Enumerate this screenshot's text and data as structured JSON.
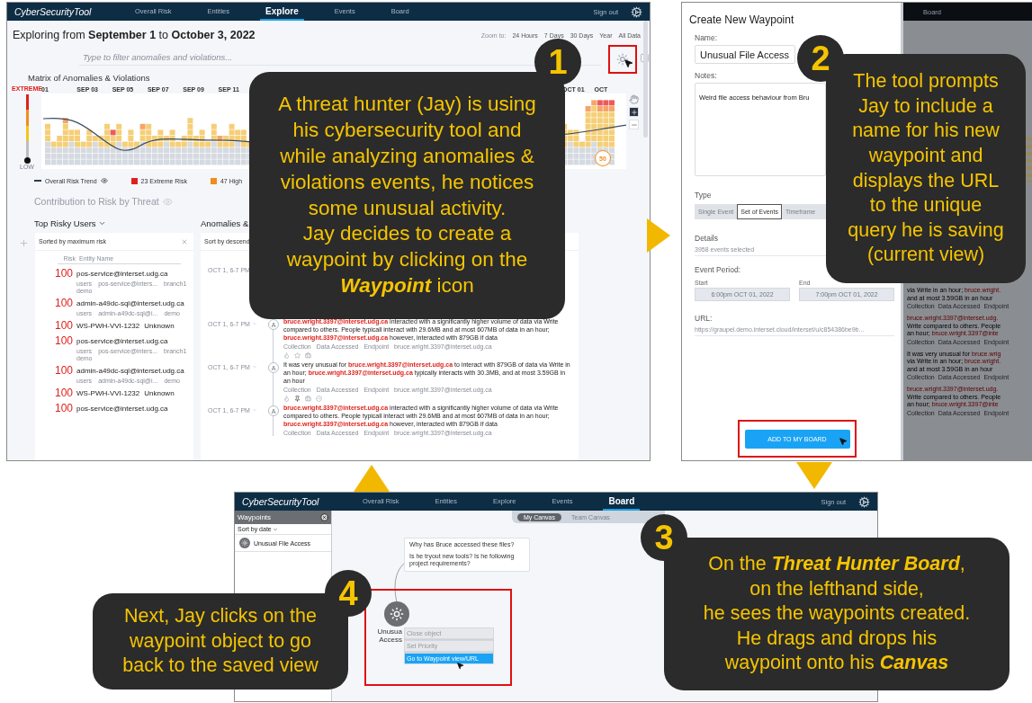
{
  "explore_screen": {
    "nav": {
      "brand": "CyberSecurityTool",
      "tabs": [
        {
          "label": "Overall Risk",
          "selected": false
        },
        {
          "label": "Entities",
          "selected": false
        },
        {
          "label": "Explore",
          "selected": true
        },
        {
          "label": "Events",
          "selected": false
        },
        {
          "label": "Board",
          "selected": false
        }
      ],
      "sign_out": "Sign out"
    },
    "heading": "Exploring from **September 1** to **October 3, 2022**",
    "zoom": {
      "label": "Zoom to:",
      "options": [
        "24 Hours",
        "7 Days",
        "30 Days",
        "Year",
        "All Data"
      ]
    },
    "filter": {
      "placeholder": "Type to filter anomalies and violations..."
    },
    "matrix": {
      "title": "Matrix of Anomalies & Violations",
      "scale_high": "EXTREME",
      "scale_low": "LOW",
      "dates": [
        "01",
        "SEP 03",
        "SEP 05",
        "SEP 07",
        "SEP 09",
        "SEP 11"
      ],
      "dates_right": [
        "OCT 01",
        "OCT"
      ],
      "trend_badge": "50"
    },
    "legend": [
      {
        "kind": "line",
        "label": "Overall Risk Trend"
      },
      {
        "kind": "swatch",
        "color": "#e0201b",
        "label": "23 Extreme Risk"
      },
      {
        "kind": "swatch",
        "color": "#f28c1e",
        "label": "47 High"
      }
    ],
    "contribution_title": "Contribution to Risk by Threat",
    "users": {
      "title": "Top Risky Users",
      "sort_label": "Sorted by maximum risk",
      "columns": [
        "Risk",
        "Entity Name"
      ],
      "rows": [
        {
          "risk": "100",
          "name": "pos-service@interset.udg.ca",
          "tags": [
            "users",
            "pos-service@inters...",
            "branch1",
            "demo"
          ]
        },
        {
          "risk": "100",
          "name": "admin-a49dc-sql@interset.udg.ca",
          "tags": [
            "users",
            "admin-a49dc-sql@i...",
            "demo"
          ]
        },
        {
          "risk": "100",
          "name": "WS-PWH-VVI-1232",
          "extra": "Unknown",
          "tags": []
        },
        {
          "risk": "100",
          "name": "pos-service@interset.udg.ca",
          "tags": [
            "users",
            "pos-service@inters...",
            "branch1",
            "demo"
          ]
        },
        {
          "risk": "100",
          "name": "admin-a49dc-sql@interset.udg.ca",
          "tags": [
            "users",
            "admin-a49dc-sql@i...",
            "demo"
          ]
        },
        {
          "risk": "100",
          "name": "WS-PWH-VVI-1232",
          "extra": "Unknown",
          "tags": []
        },
        {
          "risk": "100",
          "name": "pos-service@interset.udg.ca",
          "tags": []
        }
      ]
    },
    "anomalies": {
      "title": "Anomalies &",
      "sort_label": "Sort by descend",
      "events": [
        {
          "time": "OCT 1, 6-7 PM"
        },
        {
          "time": "OCT 1, 6-7 PM",
          "badge": "A",
          "text": "**bruce.wright.3397@interset.udg.ca** interacted with a significantly higher volume of data via Write compared to others. People typicall interact with 29.6MB and at most 607MB of data in an hour; **bruce.wright.3397@interset.udg.ca** however, interacted with 879GB if data",
          "tags": [
            "Collection",
            "Data Accessed",
            "Endpoint",
            "bruce.wright.3397@interset.udg.ca"
          ]
        },
        {
          "time": "OCT 1, 6-7 PM",
          "badge": "A",
          "text": "It was very unusual for **bruce.wright.3397@interset.udg.ca** to interact with 879GB of data via Write in an hour; **bruce.wright.3397@interset.udg.ca** typically interacts with 30.3MB, and at most 3.59GB in an hour",
          "tags": [
            "Collection",
            "Data Accessed",
            "Endpoint",
            "bruce.wright.3397@interset.udg.ca"
          ]
        },
        {
          "time": "OCT 1, 6-7 PM",
          "badge": "A",
          "text": "**bruce.wright.3397@interset.udg.ca** interacted with a significantly higher volume of data via Write compared to others. People typicall interact with 29.6MB and at most 607MB of data in an hour; **bruce.wright.3397@interset.udg.ca** however, interacted with 879GB if data",
          "tags": [
            "Collection",
            "Data Accessed",
            "Endpoint",
            "bruce.wright.3397@interset.udg.ca"
          ]
        }
      ]
    }
  },
  "waypoint_screen": {
    "title": "Create New Waypoint",
    "name_label": "Name:",
    "name_value": "Unusual File Access",
    "notes_label": "Notes:",
    "notes_value": "Weird file access behaviour from Bru",
    "type_label": "Type",
    "type_options": [
      {
        "label": "Single Event",
        "selected": false
      },
      {
        "label": "Set of Events",
        "selected": true
      },
      {
        "label": "Timeframe",
        "selected": false
      }
    ],
    "details_label": "Details",
    "details_value": "3958 events selected",
    "period_label": "Event Period:",
    "start_label": "Start",
    "start_value": "6:00pm OCT 01, 2022",
    "end_label": "End",
    "end_value": "7:00pm OCT 01, 2022",
    "url_label": "URL:",
    "url_value": "https://graupel.demo.interset.cloud/interset/u/c854386be9b...",
    "button": "ADD TO MY BOARD",
    "background": {
      "tab": "Board",
      "entries": [
        {
          "lines": [
            "via Write in an hour; **bruce.wright.**",
            "and at most 3.59GB in an hour"
          ],
          "tags": [
            "Collection",
            "Data Accessed",
            "Endpoint"
          ]
        },
        {
          "lines": [
            "**bruce.wright.3397@interset.udg.**",
            "Write compared to others. People",
            "an hour; **bruce.wright.3397@inte**"
          ],
          "tags": [
            "Collection",
            "Data Accessed",
            "Endpoint"
          ]
        },
        {
          "lines": [
            "It was very unusual for **bruce.wrig**",
            "via Write in an hour; **bruce.wright.**",
            "and at most 3.59GB in an hour"
          ],
          "tags": [
            "Collection",
            "Data Accessed",
            "Endpoint"
          ]
        },
        {
          "lines": [
            "**bruce.wright.3397@interset.udg.**",
            "Write compared to others. People",
            "an hour; **bruce.wright.3397@inte**"
          ],
          "tags": [
            "Collection",
            "Data Accessed",
            "Endpoint"
          ]
        }
      ]
    }
  },
  "board_screen": {
    "nav": {
      "brand": "CyberSecurityTool",
      "tabs": [
        {
          "label": "Overall Risk",
          "selected": false
        },
        {
          "label": "Entities",
          "selected": false
        },
        {
          "label": "Explore",
          "selected": false
        },
        {
          "label": "Events",
          "selected": false
        },
        {
          "label": "Board",
          "selected": true
        }
      ],
      "sign_out": "Sign out"
    },
    "sidebar": {
      "title": "Waypoints",
      "sort_label": "Sort by date",
      "items": [
        {
          "label": "Unusual File Access"
        }
      ]
    },
    "canvas_tabs": [
      {
        "label": "My Canvas",
        "selected": true
      },
      {
        "label": "Team Canvas",
        "selected": false
      }
    ],
    "note": {
      "lines": [
        "Why has Bruce accessed these files?",
        "Is he tryout new tools? Is he following project requirements?"
      ]
    },
    "node": {
      "label_lines": [
        "Unusua",
        "Access"
      ]
    },
    "menu": [
      {
        "label": "Close object",
        "selected": false
      },
      {
        "label": "Set Priority",
        "selected": false
      },
      {
        "label": "Go to Waypoint view/URL",
        "selected": true
      }
    ]
  },
  "callouts": [
    {
      "number": "1",
      "lines": [
        "A threat hunter (Jay) is using",
        "his cybersecurity tool and",
        "while analyzing anomalies &",
        "violations events, he notices",
        "some unusual activity.",
        "Jay decides to create a",
        "waypoint by clicking on the",
        "**Waypoint** icon"
      ]
    },
    {
      "number": "2",
      "lines": [
        "The tool prompts",
        "Jay to include a",
        "name for his new",
        "waypoint and",
        "displays the URL",
        "to the unique",
        "query he is saving",
        "(current view)"
      ]
    },
    {
      "number": "4",
      "lines": [
        "Next, Jay clicks on the",
        "waypoint object to go",
        "back to the saved view"
      ]
    },
    {
      "number": "3",
      "lines": [
        "On the **Threat Hunter Board**,",
        "on the lefthand side,",
        "he sees the waypoints created.",
        "He drags and drops his",
        "waypoint onto his **Canvas**"
      ]
    }
  ]
}
